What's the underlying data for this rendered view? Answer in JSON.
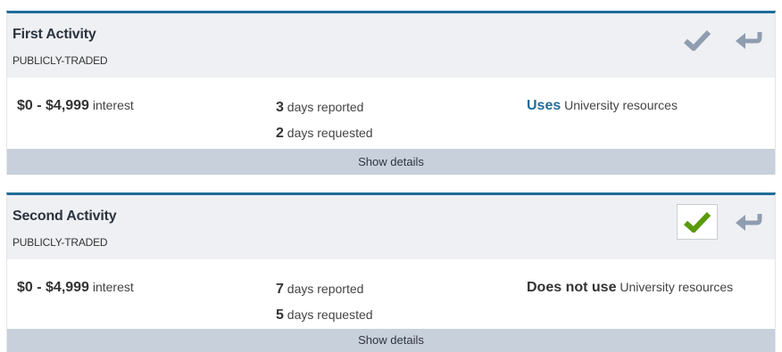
{
  "colors": {
    "accent": "#1f6d9a",
    "check_green": "#5a9a0a",
    "icon_gray": "#8f9db0",
    "header_bg": "#eff0f3",
    "details_bar_bg": "#c8d0dc"
  },
  "activities": [
    {
      "title": "First Activity",
      "subtitle": "PUBLICLY-TRADED",
      "interest_range": "$0 - $4,999",
      "interest_suffix": "interest",
      "days_reported_num": "3",
      "days_reported_label": "days reported",
      "days_requested_num": "2",
      "days_requested_label": "days requested",
      "resources_prefix": "Uses",
      "resources_suffix": "University resources",
      "approve_icon": "check-icon",
      "approve_state": "unselected",
      "return_icon": "reply-arrow-icon",
      "details_label": "Show details"
    },
    {
      "title": "Second Activity",
      "subtitle": "PUBLICLY-TRADED",
      "interest_range": "$0 - $4,999",
      "interest_suffix": "interest",
      "days_reported_num": "7",
      "days_reported_label": "days reported",
      "days_requested_num": "5",
      "days_requested_label": "days requested",
      "resources_prefix": "Does not use",
      "resources_suffix": "University resources",
      "approve_icon": "check-icon",
      "approve_state": "selected",
      "return_icon": "reply-arrow-icon",
      "details_label": "Show details"
    }
  ]
}
